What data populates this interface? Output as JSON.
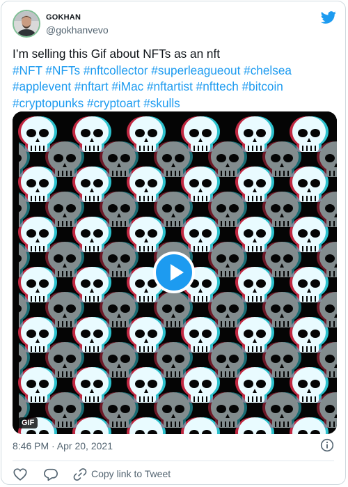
{
  "author": {
    "display_name": "GOKHAN",
    "handle": "@gokhanvevo",
    "avatar_icon": "person-avatar"
  },
  "tweet": {
    "text": "I’m selling this Gif about NFTs as an nft",
    "hashtags": "#NFT #NFTs #nftcollector #superleagueout #chelsea\n#applevent #nftart #iMac #nftartist #nfttech #bitcoin\n#cryptopunks #cryptoart #skulls",
    "timestamp": "8:46 PM · Apr 20, 2021"
  },
  "media": {
    "type_badge": "GIF",
    "subject_icon": "skull-pattern",
    "play_icon": "play-icon"
  },
  "actions": {
    "like_icon": "heart-icon",
    "reply_icon": "reply-icon",
    "copy_icon": "link-icon",
    "copy_label": "Copy link to Tweet"
  },
  "colors": {
    "accent": "#1d9bf0",
    "text": "#0f1419",
    "muted": "#536471",
    "border": "#cfd9de"
  }
}
